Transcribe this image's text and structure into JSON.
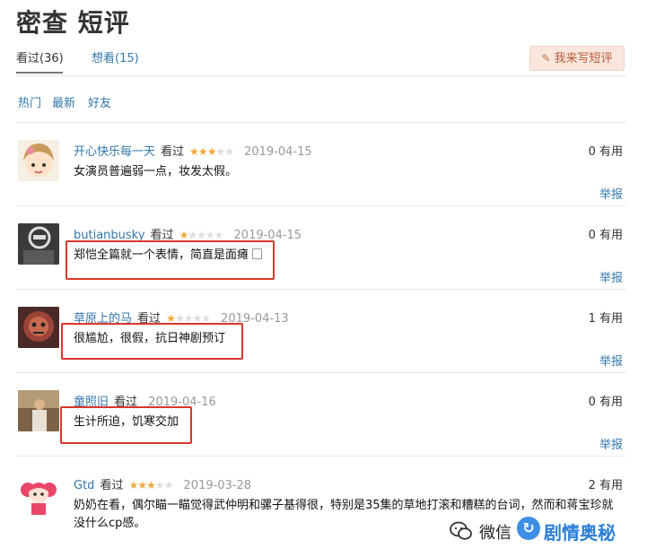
{
  "page": {
    "title": "密查 短评"
  },
  "tabs": [
    {
      "label": "看过(36)",
      "active": true
    },
    {
      "label": "想看(15)",
      "active": false
    }
  ],
  "write_button": {
    "label": "我来写短评",
    "icon": "pencil-icon"
  },
  "filters": [
    "热门",
    "最新",
    "好友"
  ],
  "reviews": [
    {
      "user": "开心快乐每一天",
      "status": "看过",
      "rating": 3,
      "date": "2019-04-15",
      "content": "女演员普遍弱一点，妆发太假。",
      "useful": "0 有用",
      "report": "举报",
      "highlighted": false
    },
    {
      "user": "butianbusky",
      "status": "看过",
      "rating": 1,
      "date": "2019-04-15",
      "content": "郑恺全篇就一个表情，简直是面瘫",
      "useful": "0 有用",
      "report": "举报",
      "highlighted": true
    },
    {
      "user": "草原上的马",
      "status": "看过",
      "rating": 1,
      "date": "2019-04-13",
      "content": "很尴尬，很假，抗日神剧预订",
      "useful": "1 有用",
      "report": "举报",
      "highlighted": true
    },
    {
      "user": "童照旧",
      "status": "看过",
      "rating": null,
      "date": "2019-04-16",
      "content": "生计所迫，饥寒交加",
      "useful": "0 有用",
      "report": "举报",
      "highlighted": true
    },
    {
      "user": "Gtd",
      "status": "看过",
      "rating": 3,
      "date": "2019-03-28",
      "content_line1": "奶奶在看，偶尔瞄一瞄觉得武仲明和骡子基得很，特别是35集的草地打滚和糟糕的台词，然而和蒋宝珍就",
      "content_line2": "没什么cp感。",
      "useful": "2 有用",
      "report": "举报",
      "highlighted": false
    }
  ],
  "watermark": {
    "prefix": "微信",
    "brand": "剧情奥秘"
  },
  "colors": {
    "link": "#3377aa",
    "star": "#f3a73b",
    "highlight": "#d9372c",
    "button_bg": "#f9e6dc"
  }
}
